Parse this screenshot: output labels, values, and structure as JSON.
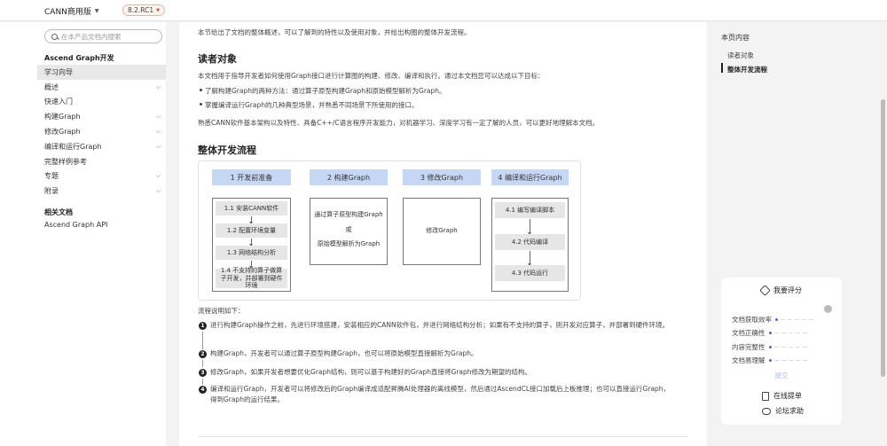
{
  "header": {
    "product": "CANN商用版",
    "version": "8.2.RC1"
  },
  "sidebar": {
    "search_placeholder": "在本产品文档内搜索",
    "section_title": "Ascend Graph开发",
    "items": [
      {
        "label": "学习向导",
        "expandable": false,
        "active": true
      },
      {
        "label": "概述",
        "expandable": true
      },
      {
        "label": "快速入门",
        "expandable": false
      },
      {
        "label": "构建Graph",
        "expandable": true
      },
      {
        "label": "修改Graph",
        "expandable": true
      },
      {
        "label": "编译和运行Graph",
        "expandable": true
      },
      {
        "label": "完整样例参考",
        "expandable": false
      },
      {
        "label": "专题",
        "expandable": true
      },
      {
        "label": "附录",
        "expandable": true
      }
    ],
    "related_title": "相关文档",
    "related_link": "Ascend Graph API"
  },
  "content": {
    "intro": "本节给出了文档的整体概述，可以了解到的特性以及使用对象，并给出构图的整体开发流程。",
    "readers_heading": "读者对象",
    "readers_text": "本文档用于指导开发者如何使用Graph接口进行计算图的构建、修改、编译和执行。通过本文档您可以达成以下目标：",
    "goals": [
      "了解构建Graph的两种方法：通过算子原型构建Graph和原始模型解析为Graph。",
      "掌握编译运行Graph的几种典型场景，并熟悉不同场景下所使用的接口。"
    ],
    "skills_text": "熟悉CANN软件基本架构以及特性、具备C++/C语言程序开发能力，对机器学习、深度学习有一定了解的人员，可以更好地理解本文档。",
    "flow_heading": "整体开发流程",
    "diagram": {
      "col1": {
        "head": "1 开发前准备",
        "steps": [
          "1.1 安装CANN软件",
          "1.2 配置环境变量",
          "1.3 网络结构分析",
          "1.4 不支持的算子做算子开发，并部署到硬件环境"
        ]
      },
      "col2": {
        "head": "2 构建Graph",
        "line1": "通过算子原型构建Graph",
        "or": "或",
        "line2": "原始模型解析为Graph"
      },
      "col3": {
        "head": "3 修改Graph",
        "text": "修改Graph"
      },
      "col4": {
        "head": "4 编译和运行Graph",
        "steps": [
          "4.1 编写编译脚本",
          "4.2 代码编译",
          "4.3 代码运行"
        ]
      }
    },
    "steps_title": "流程说明如下：",
    "steps": [
      {
        "num": "1",
        "text": "进行构建Graph操作之前，先进行环境搭建，安装相应的CANN软件包，并进行网络结构分析；如果有不支持的算子，则开发对应算子，并部署到硬件环境。"
      },
      {
        "num": "2",
        "text": "构建Graph，开发者可以通过算子原型构建Graph，也可以将原始模型直接解析为Graph。"
      },
      {
        "num": "3",
        "text": "修改Graph，如果开发者想要优化Graph结构，则可以基于构建好的Graph直接将Graph修改为期望的结构。"
      },
      {
        "num": "4",
        "text": "编译和运行Graph，开发者可以将修改后的Graph编译成适配昇腾AI处理器的离线模型，然后通过AscendCL接口加载后上板推理；也可以直接运行Graph，得到Graph的运行结果。"
      }
    ]
  },
  "toc": {
    "title": "本页内容",
    "items": [
      {
        "label": "读者对象",
        "active": false
      },
      {
        "label": "整体开发流程",
        "active": true
      }
    ]
  },
  "rating": {
    "title": "我要评分",
    "rows": [
      "文档获取效率",
      "文档正确性",
      "内容完整性",
      "文档易理解"
    ],
    "submit": "提交",
    "link1": "在线提单",
    "link2": "论坛求助",
    "accent_color": "#3b6fd9"
  }
}
